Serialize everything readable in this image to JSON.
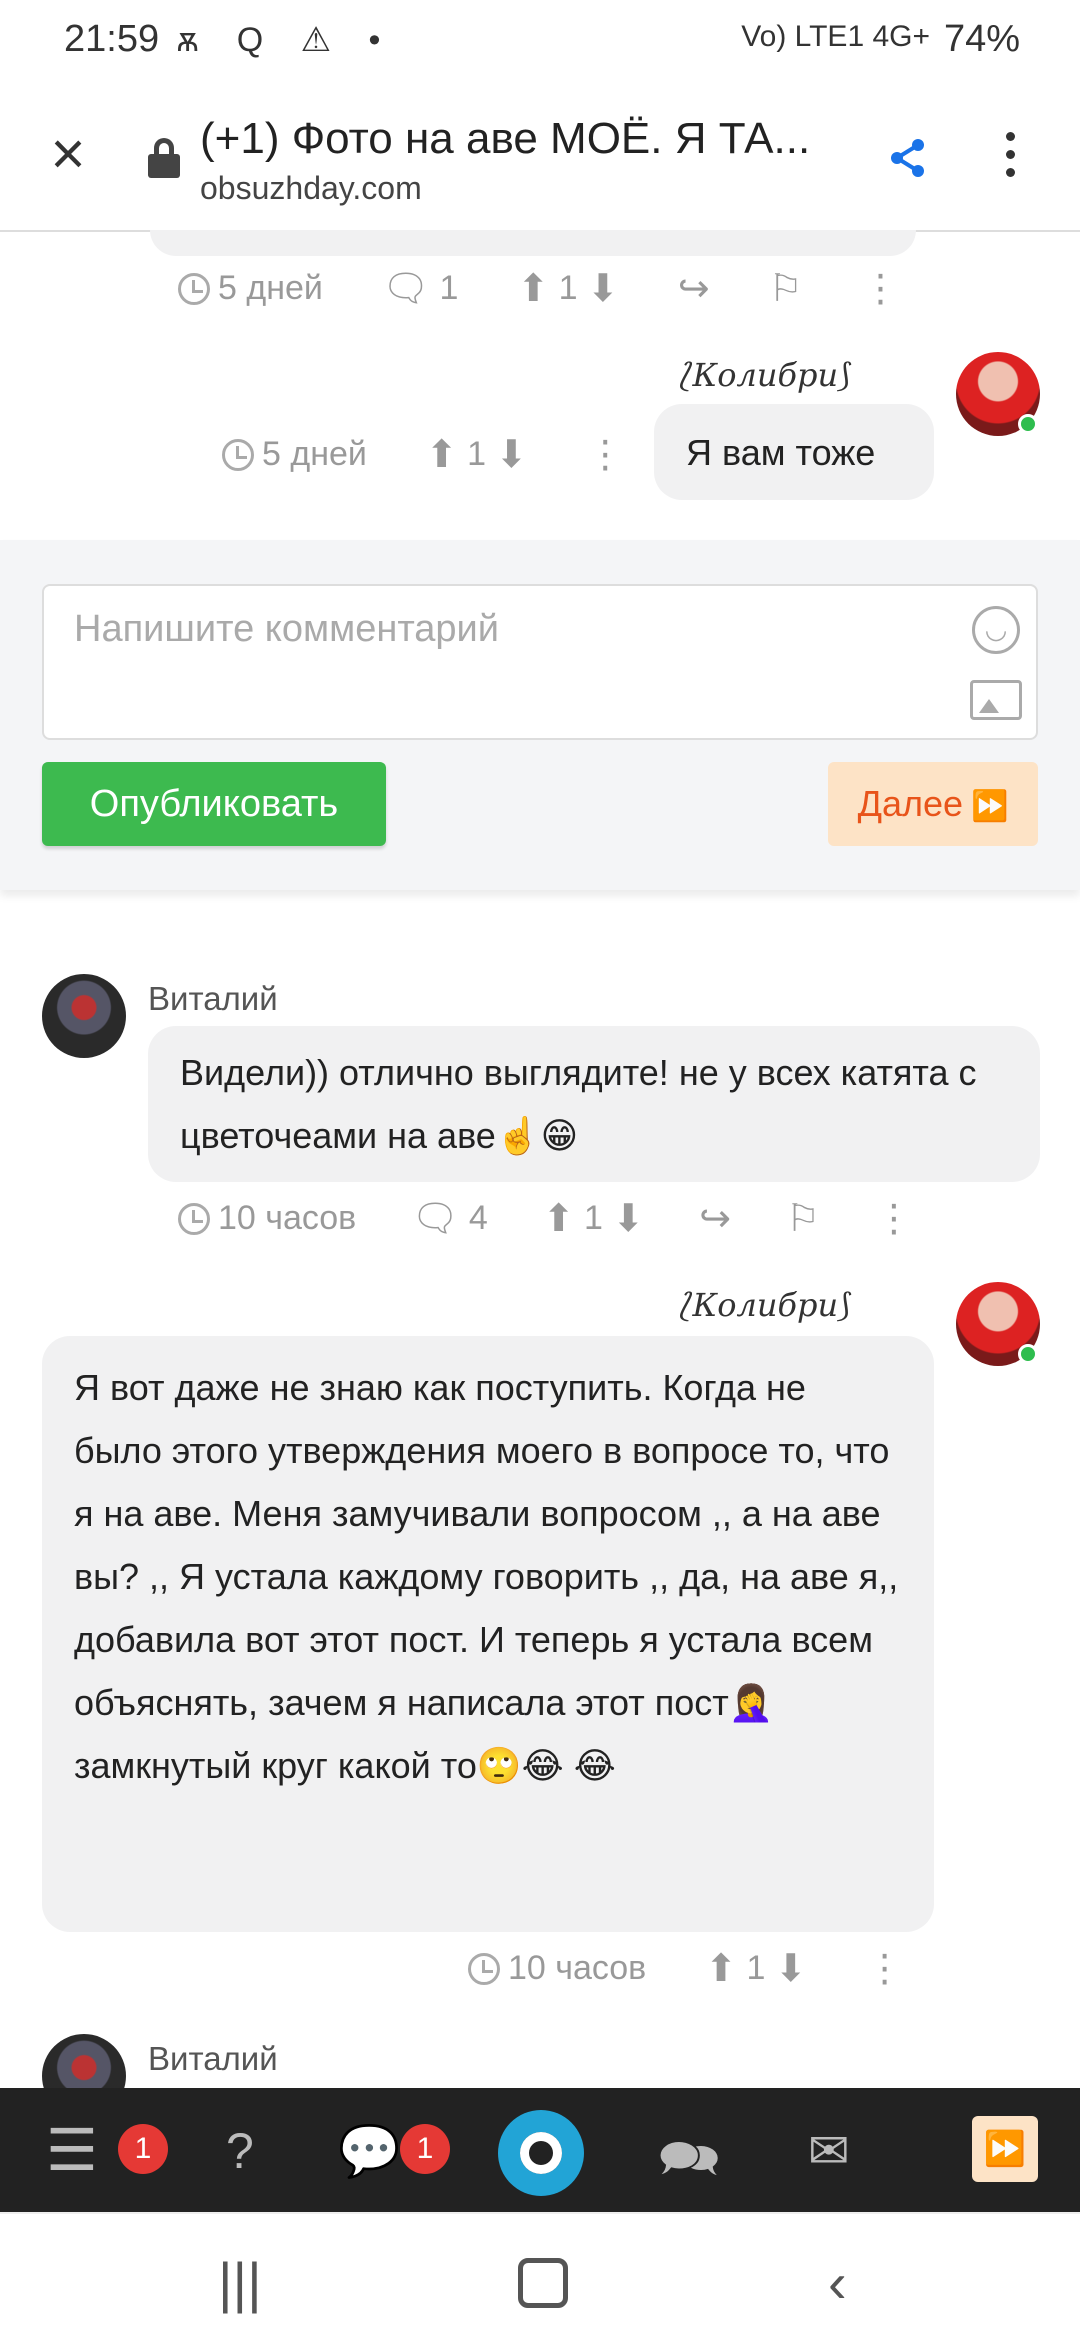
{
  "status_bar": {
    "time": "21:59",
    "left_icons": "ѫ Q ⚠ •",
    "network": "Vo) LTE1 4G+",
    "battery": "74%"
  },
  "browser": {
    "title": "(+1) Фото на аве МОЁ. Я ТА...",
    "url": "obsuzhday.com",
    "close_icon": "close-icon",
    "share_icon": "share-icon"
  },
  "thread": [
    {
      "id": "prev-meta",
      "time": "5 дней",
      "replies": "1",
      "votes": "1"
    },
    {
      "id": "kolibri-1",
      "author": "Колибри",
      "author_decor_left": "⟆",
      "text": "Я вам тоже",
      "time": "5 дней",
      "votes": "1"
    },
    {
      "id": "vitaly-1",
      "author": "Виталий",
      "text": "Видели)) отлично выглядите! не у всех катята с цветочеами на аве☝️😁",
      "time": "10 часов",
      "replies": "4",
      "votes": "1"
    },
    {
      "id": "kolibri-2",
      "author": "Колибри",
      "text": "Я вот даже не знаю как поступить. Когда не было этого утверждения моего в вопросе то, что я на аве. Меня замучивали вопросом ,, а на аве вы? ,, Я устала каждому говорить ,, да, на аве я,, добавила вот этот пост. И теперь я устала всем объяснять, зачем я написала этот пост🤦‍♀️ замкнутый круг какой то🙄😂 😂",
      "time": "10 часов",
      "votes": "1"
    },
    {
      "id": "vitaly-2",
      "author": "Виталий"
    }
  ],
  "composer": {
    "placeholder": "Напишите комментарий",
    "publish_label": "Опубликовать",
    "next_label": "Далее"
  },
  "bottom_nav": {
    "menu_badge": "1",
    "chat_badge": "1"
  },
  "colors": {
    "green": "#3dba4f",
    "accent_orange": "#e8541a",
    "share_blue": "#1a73e8",
    "nav_bg": "#222222"
  }
}
